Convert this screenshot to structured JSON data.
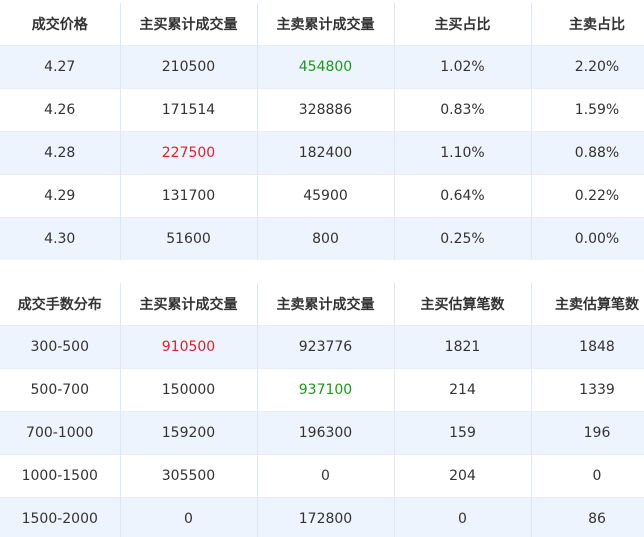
{
  "table1": {
    "headers": [
      "成交价格",
      "主买累计成交量",
      "主卖累计成交量",
      "主买占比",
      "主卖占比"
    ],
    "rows": [
      [
        "4.27",
        "210500",
        "454800",
        "1.02%",
        "2.20%"
      ],
      [
        "4.26",
        "171514",
        "328886",
        "0.83%",
        "1.59%"
      ],
      [
        "4.28",
        "227500",
        "182400",
        "1.10%",
        "0.88%"
      ],
      [
        "4.29",
        "131700",
        "45900",
        "0.64%",
        "0.22%"
      ],
      [
        "4.30",
        "51600",
        "800",
        "0.25%",
        "0.00%"
      ]
    ]
  },
  "table2": {
    "headers": [
      "成交手数分布",
      "主买累计成交量",
      "主卖累计成交量",
      "主买估算笔数",
      "主卖估算笔数"
    ],
    "rows": [
      [
        "300-500",
        "910500",
        "923776",
        "1821",
        "1848"
      ],
      [
        "500-700",
        "150000",
        "937100",
        "214",
        "1339"
      ],
      [
        "700-1000",
        "159200",
        "196300",
        "159",
        "196"
      ],
      [
        "1000-1500",
        "305500",
        "0",
        "204",
        "0"
      ],
      [
        "1500-2000",
        "0",
        "172800",
        "0",
        "86"
      ]
    ]
  },
  "colors": {
    "highlight_red": "#e0202a",
    "highlight_green": "#1a9a1a",
    "stripe": "#eef4fd"
  }
}
